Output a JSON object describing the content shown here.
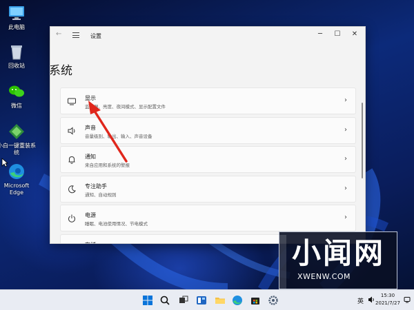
{
  "desktop": {
    "icons": [
      {
        "label": "此电脑",
        "icon": "computer-icon"
      },
      {
        "label": "回收站",
        "icon": "recycle-bin-icon"
      },
      {
        "label": "微信",
        "icon": "wechat-icon"
      },
      {
        "label": "小白一键重装系统",
        "icon": "xiaobai-installer-icon"
      },
      {
        "label": "Microsoft Edge",
        "icon": "edge-icon"
      }
    ]
  },
  "window": {
    "title": "设置",
    "back_icon": "back-arrow-icon",
    "controls": {
      "minimize": "─",
      "maximize": "☐",
      "close": "✕"
    }
  },
  "page": {
    "title": "系统"
  },
  "settings_rows": [
    {
      "title": "显示",
      "desc": "监视器、亮度、夜间模式、显示配置文件",
      "icon": "display-icon"
    },
    {
      "title": "声音",
      "desc": "音量级别、输出、输入、声音设备",
      "icon": "speaker-icon"
    },
    {
      "title": "通知",
      "desc": "来自应用和系统的警报",
      "icon": "bell-icon"
    },
    {
      "title": "专注助手",
      "desc": "通知、自动规则",
      "icon": "moon-icon"
    },
    {
      "title": "电源",
      "desc": "睡眠、电池使用情况、节电模式",
      "icon": "power-icon"
    },
    {
      "title": "存储",
      "desc": "",
      "icon": "storage-icon"
    }
  ],
  "chevron": "›",
  "watermark": {
    "big": "小闻网",
    "small": "XWENW.COM"
  },
  "taskbar": {
    "apps": [
      "windows-start-icon",
      "search-icon",
      "task-view-icon",
      "widgets-icon",
      "file-explorer-icon",
      "edge-icon",
      "store-icon",
      "settings-icon"
    ],
    "ime": "英",
    "time": "15:30",
    "date": "2021/7/27"
  },
  "colors": {
    "arrow": "#e0271c",
    "accent": "#0067c0"
  }
}
